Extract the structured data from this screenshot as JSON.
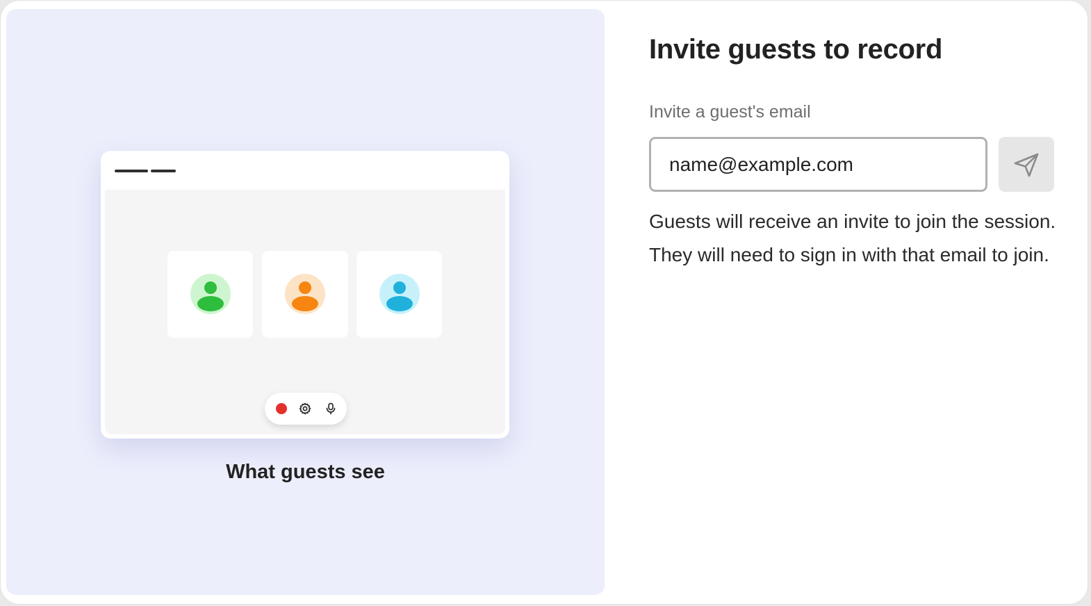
{
  "preview": {
    "caption": "What guests see",
    "participants": [
      {
        "icon": "user-avatar-icon",
        "color": "#2ebd3c",
        "bg": "#cdf5cf"
      },
      {
        "icon": "user-avatar-icon",
        "color": "#f68511",
        "bg": "#fde3c6"
      },
      {
        "icon": "user-avatar-icon",
        "color": "#1fb1dc",
        "bg": "#c6f1fb"
      }
    ],
    "controls": [
      {
        "icon": "record-icon",
        "color": "#e3302b"
      },
      {
        "icon": "gear-icon"
      },
      {
        "icon": "microphone-icon"
      }
    ]
  },
  "invite": {
    "title": "Invite guests to record",
    "email_label": "Invite a guest's email",
    "email_placeholder": "name@example.com",
    "email_value": "",
    "send_icon": "send-icon",
    "help_text": "Guests will receive an invite to join the session. They will need to sign in with that email to join."
  },
  "colors": {
    "preview_bg": "#eceefc",
    "send_button_bg": "#e6e6e6",
    "input_border": "#b1b1b1"
  }
}
